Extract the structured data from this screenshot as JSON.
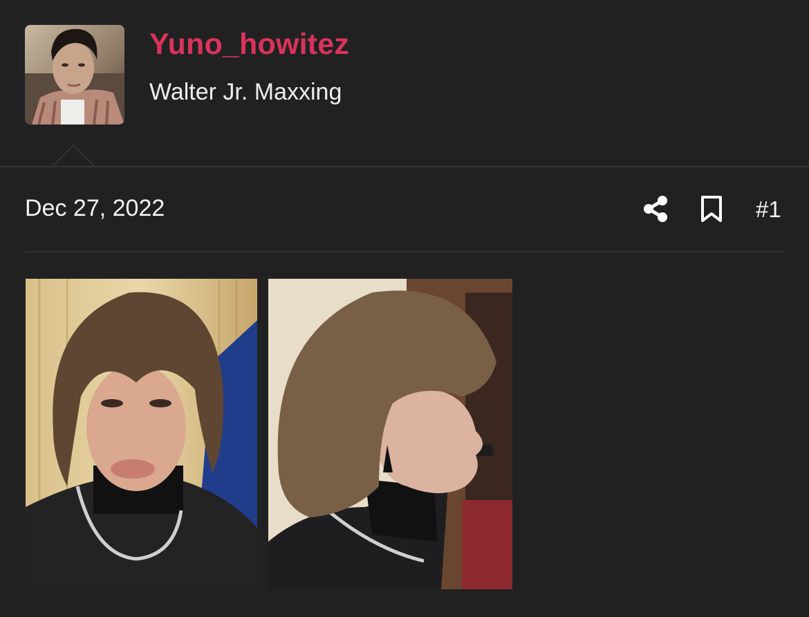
{
  "user": {
    "username": "Yuno_howitez",
    "title": "Walter Jr. Maxxing",
    "avatar_icon": "avatar-photo"
  },
  "post": {
    "date": "Dec 27, 2022",
    "number": "#1",
    "actions": {
      "share_icon": "share-icon",
      "bookmark_icon": "bookmark-icon"
    },
    "attachments": [
      {
        "kind": "photo",
        "subject": "front-view"
      },
      {
        "kind": "photo",
        "subject": "side-profile-view"
      }
    ]
  },
  "colors": {
    "background": "#212122",
    "username": "#d8335c",
    "text": "#f2f2f2",
    "divider": "#343437"
  }
}
